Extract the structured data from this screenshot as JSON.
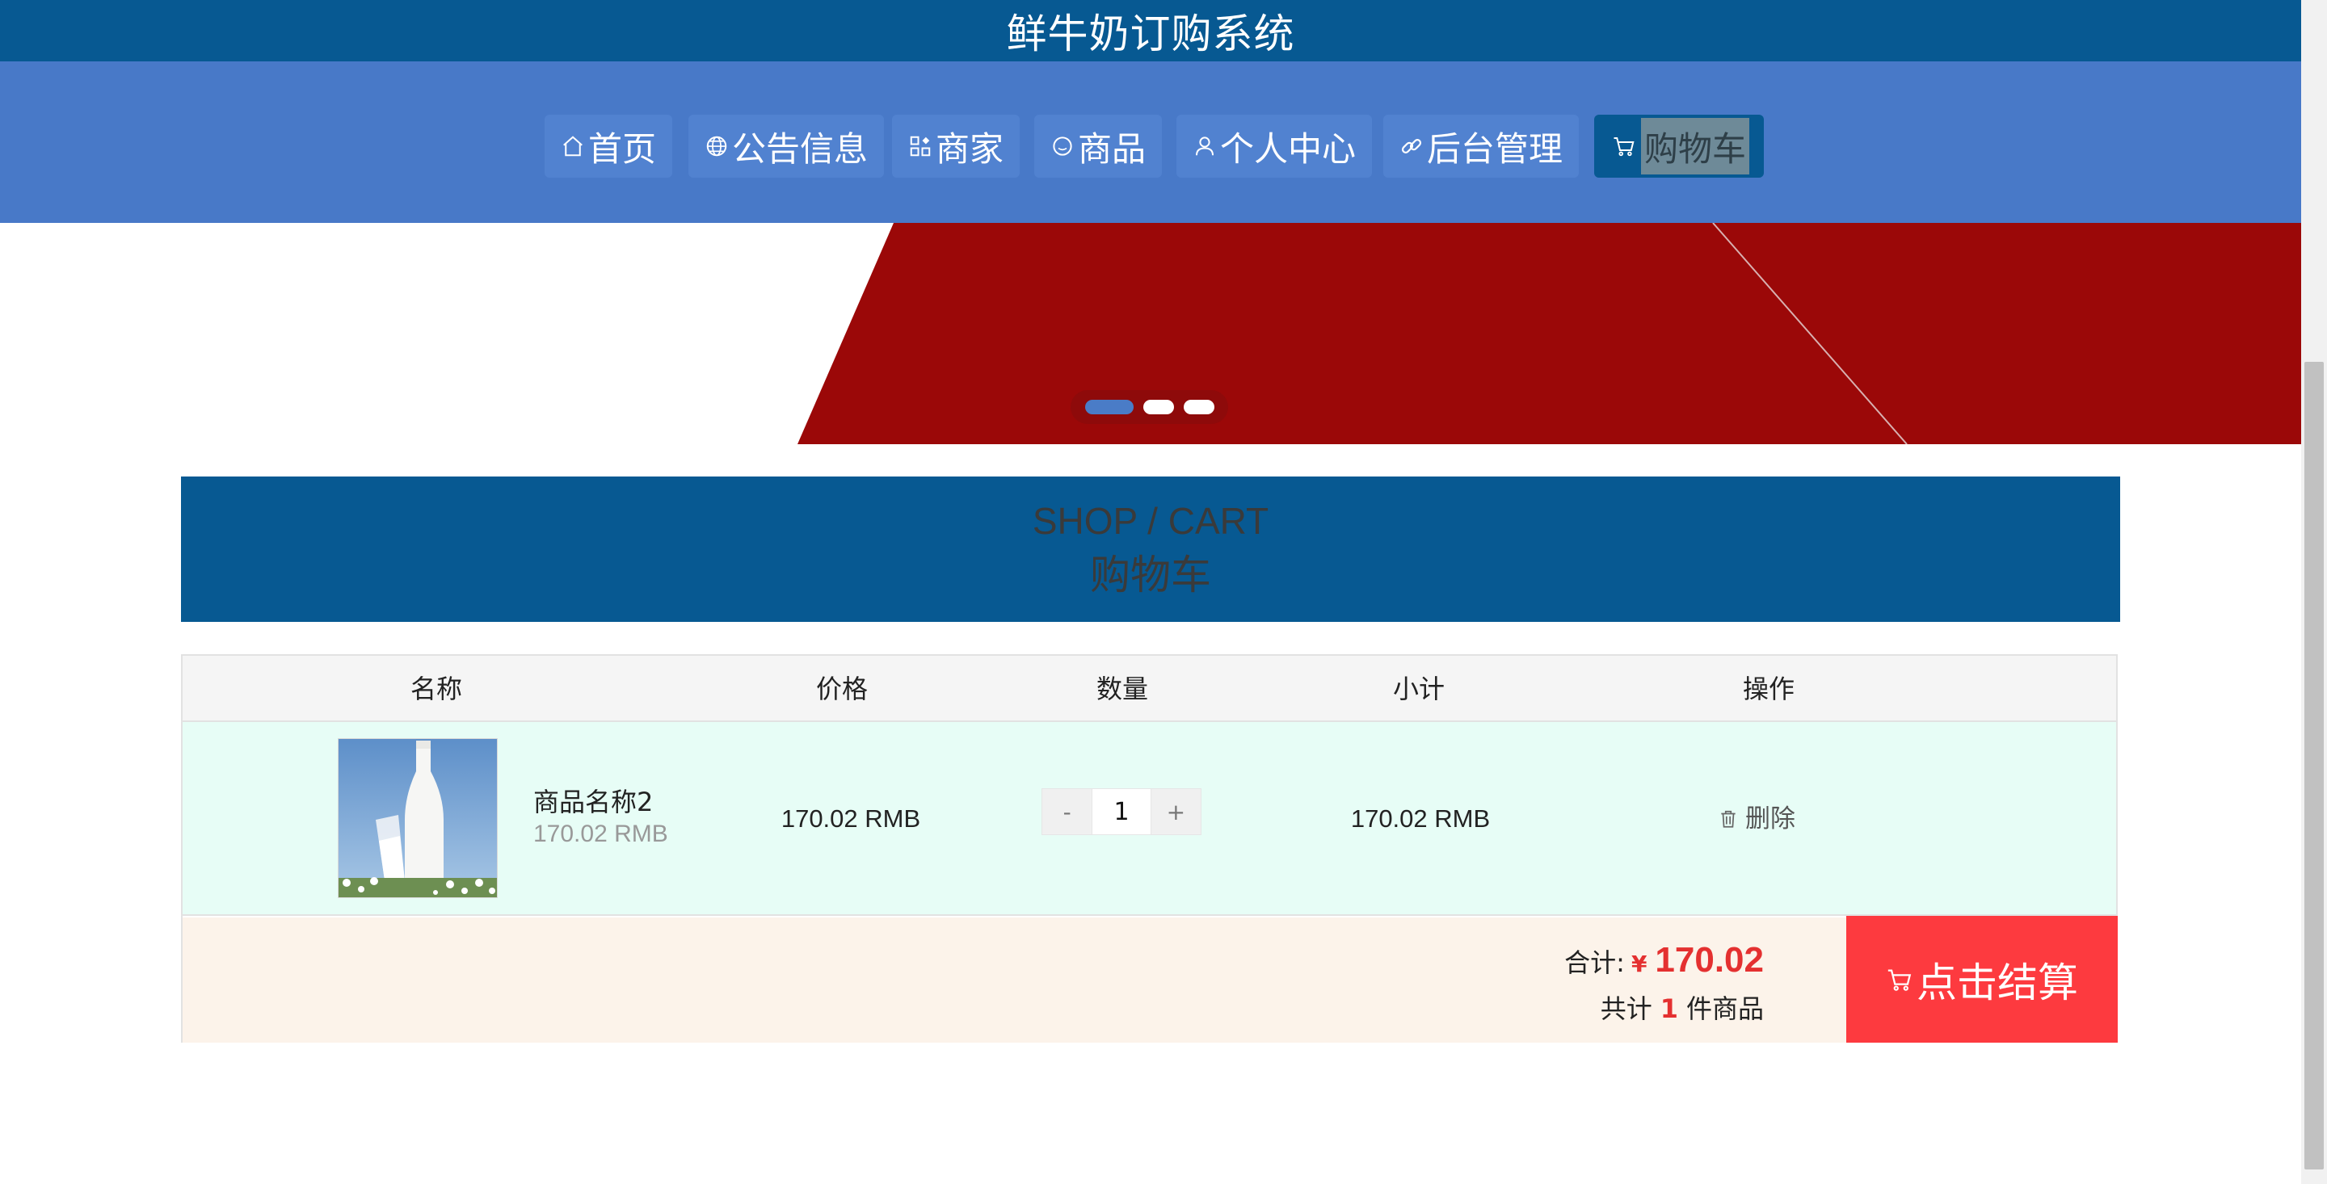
{
  "header": {
    "title": "鲜牛奶订购系统"
  },
  "nav": {
    "items": [
      {
        "label": "首页",
        "icon": "home-icon"
      },
      {
        "label": "公告信息",
        "icon": "globe-icon"
      },
      {
        "label": "商家",
        "icon": "grid-icon"
      },
      {
        "label": "商品",
        "icon": "circle-icon"
      },
      {
        "label": "个人中心",
        "icon": "user-icon"
      },
      {
        "label": "后台管理",
        "icon": "link-icon"
      },
      {
        "label": "购物车",
        "icon": "cart-icon",
        "active": true
      }
    ]
  },
  "banner": {
    "slides": 3,
    "active_slide": 1,
    "colors": {
      "red": "#9b0808",
      "white": "#ffffff"
    }
  },
  "section": {
    "title_en": "SHOP / CART",
    "title_cn": "购物车"
  },
  "cart": {
    "headers": {
      "name": "名称",
      "price": "价格",
      "quantity": "数量",
      "subtotal": "小计",
      "action": "操作"
    },
    "items": [
      {
        "name": "商品名称2",
        "unit_price": "170.02 RMB",
        "price": "170.02 RMB",
        "quantity": "1",
        "subtotal": "170.02 RMB",
        "delete_label": "删除",
        "minus": "-",
        "plus": "+"
      }
    ],
    "footer": {
      "total_label": "合计:",
      "currency": "¥",
      "total": "170.02",
      "count_prefix": "共计",
      "count": "1",
      "count_suffix": "件商品",
      "checkout_label": "点击结算"
    }
  },
  "theme": {
    "primary": "#075992",
    "nav_bg": "#4879c8",
    "accent_red": "#fd3a3f"
  }
}
